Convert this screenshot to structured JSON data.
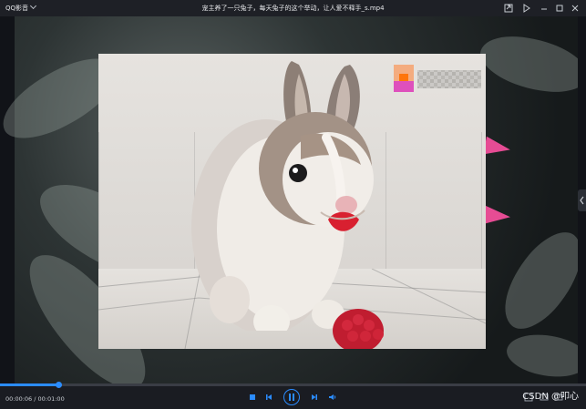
{
  "window": {
    "app_name": "QQ影音",
    "title": "宠主养了一只兔子，每天兔子的这个举动，让人爱不释手_s.mp4",
    "buttons": [
      "pip-icon",
      "send-icon",
      "minimize-icon",
      "maximize-icon",
      "close-icon"
    ]
  },
  "video": {
    "icon": "rabbit-eating-raspberry",
    "watermark": "blurred-logo"
  },
  "controls": {
    "time_text": "00:00:06 / 00:01:00",
    "progress_fraction": 0.1,
    "buttons": [
      "stop-icon",
      "previous-icon",
      "pause-icon",
      "next-icon",
      "volume-icon"
    ]
  },
  "overlay_text": "CSDN @叩心",
  "colors": {
    "accent": "#2b8cff",
    "petal": "#e64c94",
    "titlebar": "#1e2026",
    "control_bar": "#1a1c22"
  }
}
